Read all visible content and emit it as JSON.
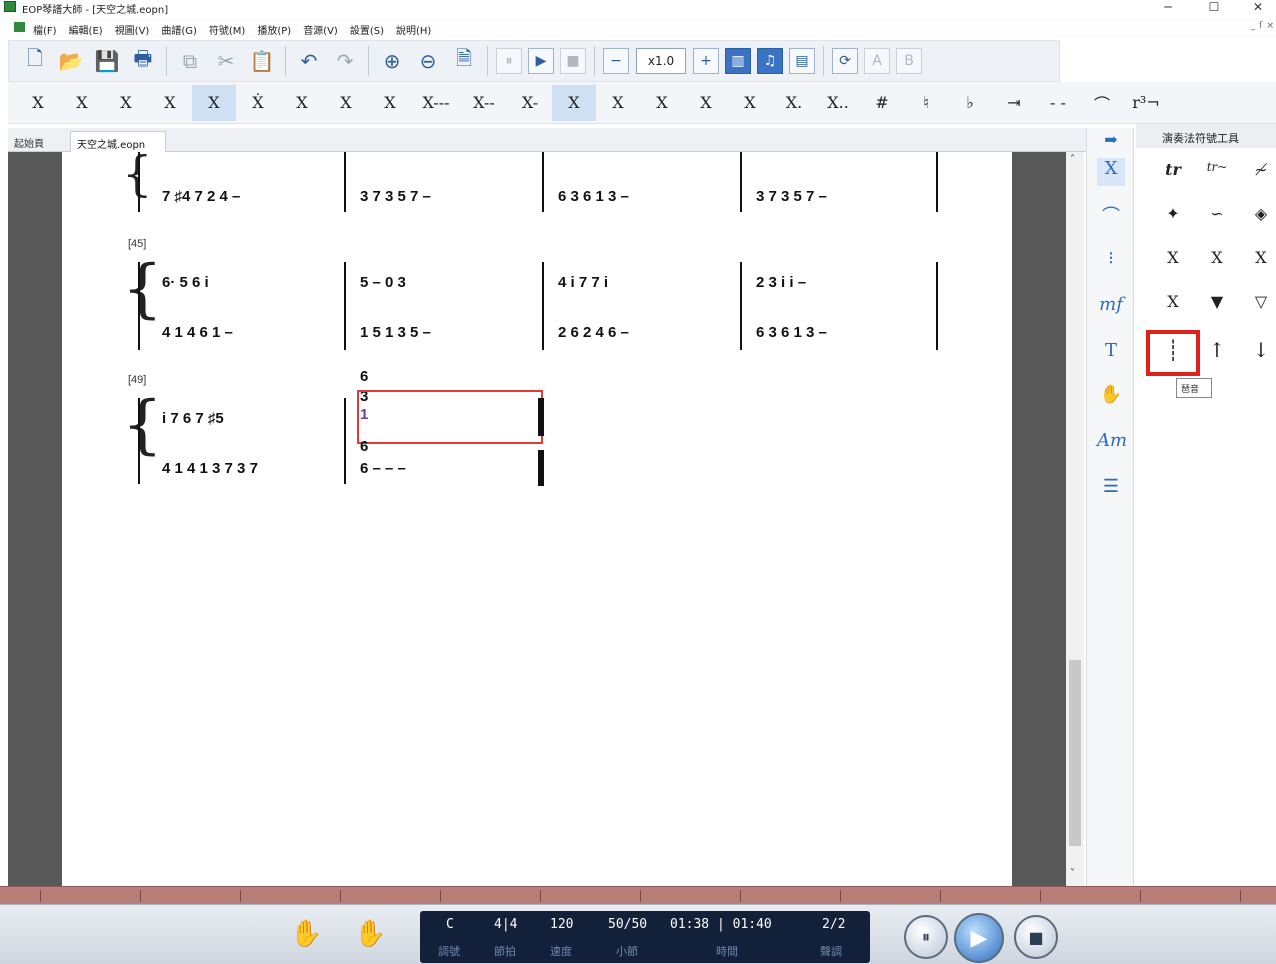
{
  "window": {
    "title": "EOP琴譜大師 - [天空之城.eopn]",
    "minimize": "─",
    "maximize": "☐",
    "close": "✕"
  },
  "menu": {
    "items": [
      "檔(F)",
      "編輯(E)",
      "視圖(V)",
      "曲譜(G)",
      "符號(M)",
      "播放(P)",
      "音源(V)",
      "設置(S)",
      "說明(H)"
    ],
    "mdi": [
      "_",
      "ſ",
      "×"
    ]
  },
  "toolbar": {
    "speed": "x1.0",
    "letter_a": "A",
    "letter_b": "B"
  },
  "notation_tools": [
    "X",
    "X",
    "X",
    "X",
    "X",
    "Ẋ",
    "X",
    "X",
    "X",
    "X---",
    "X--",
    "X-",
    "X",
    "X",
    "X",
    "X",
    "X",
    "X.",
    "X..",
    "#",
    "♮",
    "♭",
    "⇥",
    "- -",
    "⌒",
    "r³¬"
  ],
  "tabs": {
    "home": "起始頁",
    "file": "天空之城.eopn"
  },
  "score": {
    "m45": "[45]",
    "m49": "[49]",
    "row1": [
      "7 ♯4  7 2  4   –",
      "3 7  3 5  7   –",
      "6 3  6 1  3   –",
      "3 7  3 5  7   –"
    ],
    "row2a": [
      "6·     5  6    i",
      "5    –    0    3",
      "4    i 7  7    i",
      "2    3 i  i    –"
    ],
    "row2b": [
      "4 1  4 6  1   –",
      "1 5  1 3  5   –",
      "2 6  2 4  6   –",
      "6 3  6 1  3   –"
    ],
    "row3a": "i 7  6    7   ♯5",
    "row3b": [
      "4 1  4 1  3 7  3 7",
      "6    –    –    –"
    ],
    "chord_top": [
      "6",
      "3",
      "1"
    ],
    "chord_bottom": [
      "6",
      "6"
    ]
  },
  "palette": {
    "title": "演奏法符號工具",
    "cells": [
      "tr",
      "tr~",
      "≁",
      "✦",
      "∽",
      "◈",
      "X",
      "X",
      "X",
      "X",
      "▼",
      "▽",
      "┊",
      "↑",
      "↓"
    ],
    "tooltip": "琶音"
  },
  "side_icons": [
    "X",
    "⌒",
    "⁝",
    "mf",
    "T",
    "✋",
    "Am",
    "☰"
  ],
  "status": {
    "key": "C",
    "beat": "4|4",
    "tempo": "120",
    "measure": "50/50",
    "time": "01:38 | 01:40",
    "part": "2/2",
    "key_label": "調號",
    "beat_label": "節拍",
    "tempo_label": "速度",
    "measure_label": "小節",
    "time_label": "時間",
    "part_label": "聲調"
  }
}
